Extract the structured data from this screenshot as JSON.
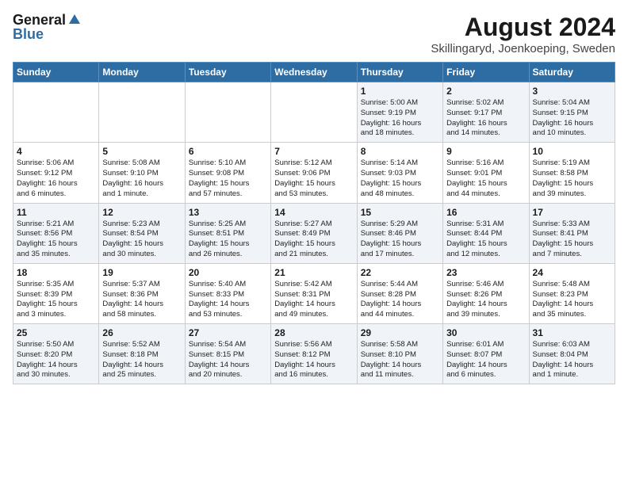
{
  "header": {
    "logo_general": "General",
    "logo_blue": "Blue",
    "title": "August 2024",
    "subtitle": "Skillingaryd, Joenkoeping, Sweden"
  },
  "days_of_week": [
    "Sunday",
    "Monday",
    "Tuesday",
    "Wednesday",
    "Thursday",
    "Friday",
    "Saturday"
  ],
  "weeks": [
    [
      {
        "day": "",
        "info": ""
      },
      {
        "day": "",
        "info": ""
      },
      {
        "day": "",
        "info": ""
      },
      {
        "day": "",
        "info": ""
      },
      {
        "day": "1",
        "info": "Sunrise: 5:00 AM\nSunset: 9:19 PM\nDaylight: 16 hours\nand 18 minutes."
      },
      {
        "day": "2",
        "info": "Sunrise: 5:02 AM\nSunset: 9:17 PM\nDaylight: 16 hours\nand 14 minutes."
      },
      {
        "day": "3",
        "info": "Sunrise: 5:04 AM\nSunset: 9:15 PM\nDaylight: 16 hours\nand 10 minutes."
      }
    ],
    [
      {
        "day": "4",
        "info": "Sunrise: 5:06 AM\nSunset: 9:12 PM\nDaylight: 16 hours\nand 6 minutes."
      },
      {
        "day": "5",
        "info": "Sunrise: 5:08 AM\nSunset: 9:10 PM\nDaylight: 16 hours\nand 1 minute."
      },
      {
        "day": "6",
        "info": "Sunrise: 5:10 AM\nSunset: 9:08 PM\nDaylight: 15 hours\nand 57 minutes."
      },
      {
        "day": "7",
        "info": "Sunrise: 5:12 AM\nSunset: 9:06 PM\nDaylight: 15 hours\nand 53 minutes."
      },
      {
        "day": "8",
        "info": "Sunrise: 5:14 AM\nSunset: 9:03 PM\nDaylight: 15 hours\nand 48 minutes."
      },
      {
        "day": "9",
        "info": "Sunrise: 5:16 AM\nSunset: 9:01 PM\nDaylight: 15 hours\nand 44 minutes."
      },
      {
        "day": "10",
        "info": "Sunrise: 5:19 AM\nSunset: 8:58 PM\nDaylight: 15 hours\nand 39 minutes."
      }
    ],
    [
      {
        "day": "11",
        "info": "Sunrise: 5:21 AM\nSunset: 8:56 PM\nDaylight: 15 hours\nand 35 minutes."
      },
      {
        "day": "12",
        "info": "Sunrise: 5:23 AM\nSunset: 8:54 PM\nDaylight: 15 hours\nand 30 minutes."
      },
      {
        "day": "13",
        "info": "Sunrise: 5:25 AM\nSunset: 8:51 PM\nDaylight: 15 hours\nand 26 minutes."
      },
      {
        "day": "14",
        "info": "Sunrise: 5:27 AM\nSunset: 8:49 PM\nDaylight: 15 hours\nand 21 minutes."
      },
      {
        "day": "15",
        "info": "Sunrise: 5:29 AM\nSunset: 8:46 PM\nDaylight: 15 hours\nand 17 minutes."
      },
      {
        "day": "16",
        "info": "Sunrise: 5:31 AM\nSunset: 8:44 PM\nDaylight: 15 hours\nand 12 minutes."
      },
      {
        "day": "17",
        "info": "Sunrise: 5:33 AM\nSunset: 8:41 PM\nDaylight: 15 hours\nand 7 minutes."
      }
    ],
    [
      {
        "day": "18",
        "info": "Sunrise: 5:35 AM\nSunset: 8:39 PM\nDaylight: 15 hours\nand 3 minutes."
      },
      {
        "day": "19",
        "info": "Sunrise: 5:37 AM\nSunset: 8:36 PM\nDaylight: 14 hours\nand 58 minutes."
      },
      {
        "day": "20",
        "info": "Sunrise: 5:40 AM\nSunset: 8:33 PM\nDaylight: 14 hours\nand 53 minutes."
      },
      {
        "day": "21",
        "info": "Sunrise: 5:42 AM\nSunset: 8:31 PM\nDaylight: 14 hours\nand 49 minutes."
      },
      {
        "day": "22",
        "info": "Sunrise: 5:44 AM\nSunset: 8:28 PM\nDaylight: 14 hours\nand 44 minutes."
      },
      {
        "day": "23",
        "info": "Sunrise: 5:46 AM\nSunset: 8:26 PM\nDaylight: 14 hours\nand 39 minutes."
      },
      {
        "day": "24",
        "info": "Sunrise: 5:48 AM\nSunset: 8:23 PM\nDaylight: 14 hours\nand 35 minutes."
      }
    ],
    [
      {
        "day": "25",
        "info": "Sunrise: 5:50 AM\nSunset: 8:20 PM\nDaylight: 14 hours\nand 30 minutes."
      },
      {
        "day": "26",
        "info": "Sunrise: 5:52 AM\nSunset: 8:18 PM\nDaylight: 14 hours\nand 25 minutes."
      },
      {
        "day": "27",
        "info": "Sunrise: 5:54 AM\nSunset: 8:15 PM\nDaylight: 14 hours\nand 20 minutes."
      },
      {
        "day": "28",
        "info": "Sunrise: 5:56 AM\nSunset: 8:12 PM\nDaylight: 14 hours\nand 16 minutes."
      },
      {
        "day": "29",
        "info": "Sunrise: 5:58 AM\nSunset: 8:10 PM\nDaylight: 14 hours\nand 11 minutes."
      },
      {
        "day": "30",
        "info": "Sunrise: 6:01 AM\nSunset: 8:07 PM\nDaylight: 14 hours\nand 6 minutes."
      },
      {
        "day": "31",
        "info": "Sunrise: 6:03 AM\nSunset: 8:04 PM\nDaylight: 14 hours\nand 1 minute."
      }
    ]
  ]
}
